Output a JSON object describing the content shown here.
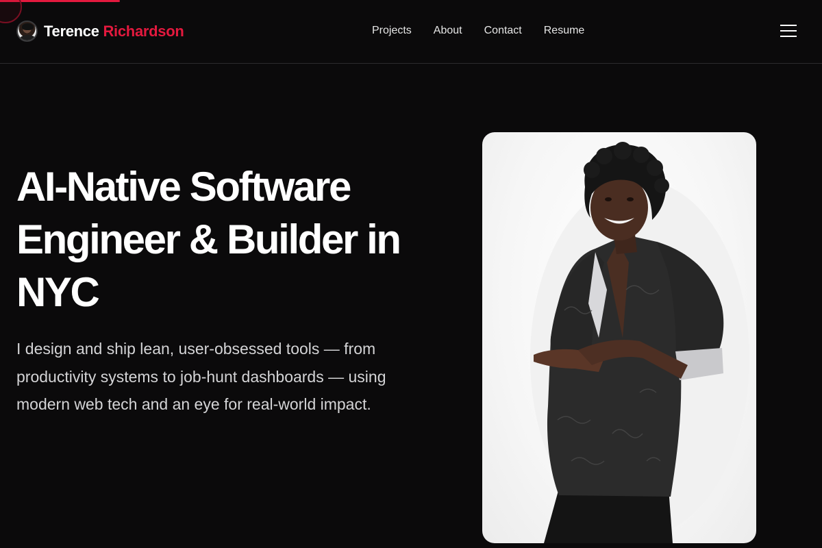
{
  "brand": {
    "first_name": "Terence",
    "last_name": "Richardson",
    "accent_color": "#e3193e"
  },
  "nav": {
    "items": [
      {
        "label": "Projects"
      },
      {
        "label": "About"
      },
      {
        "label": "Contact"
      },
      {
        "label": "Resume"
      }
    ],
    "menu_icon": "hamburger-menu-icon"
  },
  "hero": {
    "title": "AI-Native Software Engineer & Builder in NYC",
    "subtitle": "I design and ship lean, user-obsessed tools — from productivity systems to job-hunt dashboards — using modern web tech and an eye for real-world impact."
  },
  "scroll_progress": 0.146,
  "colors": {
    "background": "#0b0a0b",
    "text": "#ffffff",
    "muted_text": "#d4d4d6",
    "accent": "#e3193e"
  }
}
